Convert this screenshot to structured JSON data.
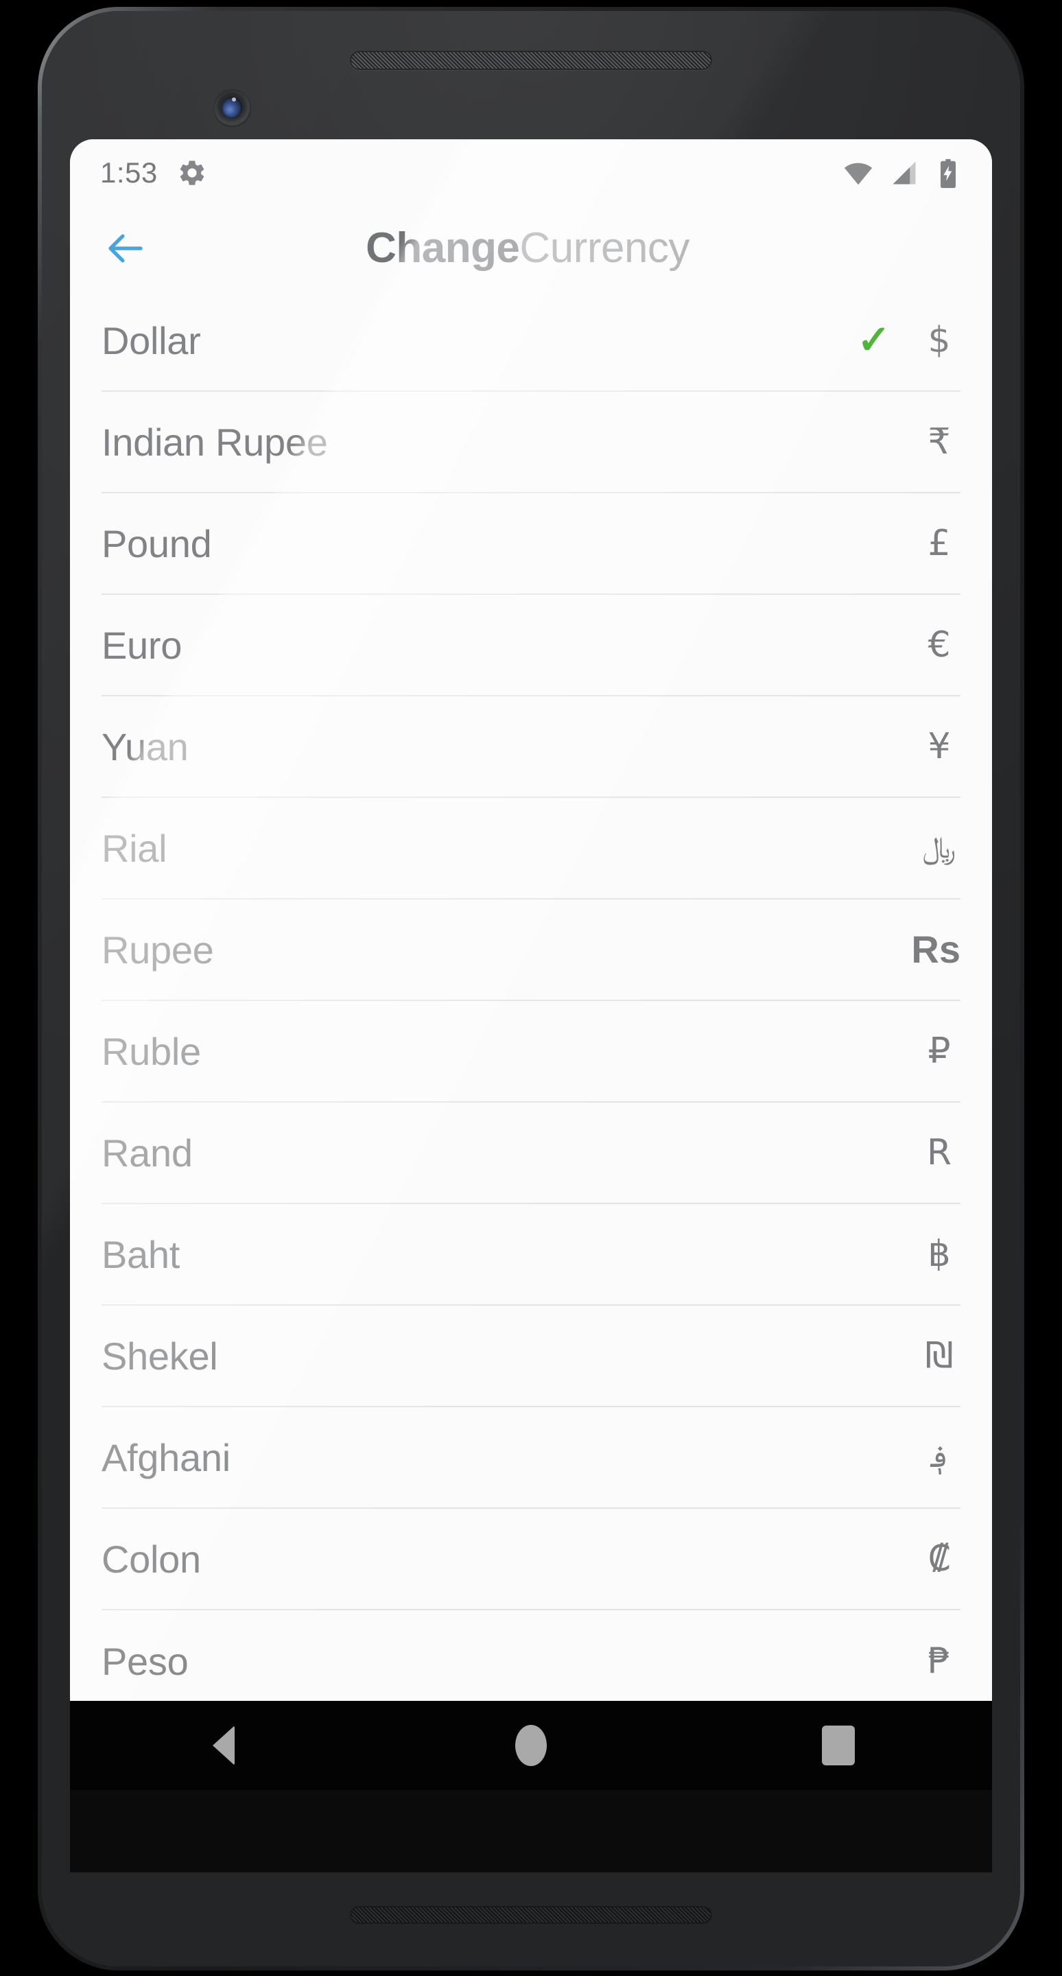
{
  "status_bar": {
    "time": "1:53",
    "icons": {
      "settings": "gear-icon",
      "wifi": "wifi-icon",
      "signal": "cell-signal-icon",
      "battery": "battery-charging-icon"
    }
  },
  "app_bar": {
    "back_label": "back-arrow",
    "title_bold": "Change",
    "title_light": "Currency",
    "back_color": "#3f9fd8"
  },
  "colors": {
    "accent_check": "#3dab25",
    "text_primary": "#7b7d80",
    "screen_bg": "#fbfbfb",
    "divider": "#e3e4e5"
  },
  "currency_list": [
    {
      "name": "Dollar",
      "symbol": "$",
      "selected": true,
      "check": "✓"
    },
    {
      "name": "Indian Rupee",
      "symbol": "₹",
      "selected": false,
      "check": ""
    },
    {
      "name": "Pound",
      "symbol": "£",
      "selected": false,
      "check": ""
    },
    {
      "name": "Euro",
      "symbol": "€",
      "selected": false,
      "check": ""
    },
    {
      "name": "Yuan",
      "symbol": "¥",
      "selected": false,
      "check": ""
    },
    {
      "name": "Rial",
      "symbol": "﷼",
      "selected": false,
      "check": ""
    },
    {
      "name": "Rupee",
      "symbol": "Rs",
      "selected": false,
      "check": ""
    },
    {
      "name": "Ruble",
      "symbol": "₽",
      "selected": false,
      "check": ""
    },
    {
      "name": "Rand",
      "symbol": "R",
      "selected": false,
      "check": ""
    },
    {
      "name": "Baht",
      "symbol": "฿",
      "selected": false,
      "check": ""
    },
    {
      "name": "Shekel",
      "symbol": "₪",
      "selected": false,
      "check": ""
    },
    {
      "name": "Afghani",
      "symbol": "؋",
      "selected": false,
      "check": ""
    },
    {
      "name": "Colon",
      "symbol": "₡",
      "selected": false,
      "check": ""
    },
    {
      "name": "Peso",
      "symbol": "₱",
      "selected": false,
      "check": ""
    }
  ],
  "system_nav": {
    "back": "nav-back-triangle",
    "home": "nav-home-circle",
    "recents": "nav-recents-square"
  }
}
